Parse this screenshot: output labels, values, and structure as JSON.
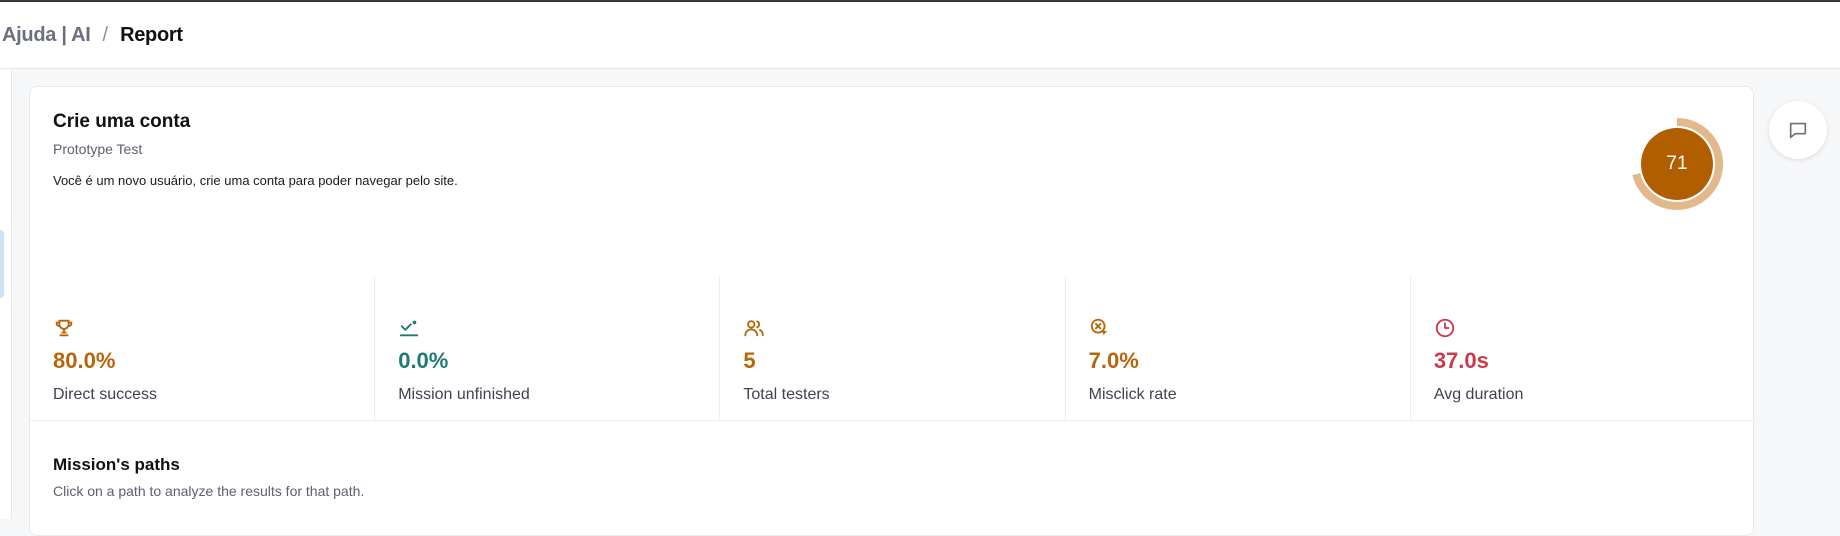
{
  "breadcrumb": {
    "root": "Ajuda | AI",
    "separator": "/",
    "current": "Report"
  },
  "mission": {
    "title": "Crie uma conta",
    "type": "Prototype Test",
    "description": "Você é um novo usuário, crie uma conta para poder navegar pelo site.",
    "score": "71",
    "score_fraction": 0.71
  },
  "stats": [
    {
      "icon": "trophy-icon",
      "value": "80.0%",
      "label": "Direct success",
      "color": "#b8650a"
    },
    {
      "icon": "path-arrow-icon",
      "value": "0.0%",
      "label": "Mission unfinished",
      "color": "#1f7a76"
    },
    {
      "icon": "users-icon",
      "value": "5",
      "label": "Total testers",
      "color": "#b8650a"
    },
    {
      "icon": "misclick-target-icon",
      "value": "7.0%",
      "label": "Misclick rate",
      "color": "#b8650a"
    },
    {
      "icon": "clock-icon",
      "value": "37.0s",
      "label": "Avg duration",
      "color": "#cc3a4a"
    }
  ],
  "paths": {
    "title": "Mission's paths",
    "subtitle": "Click on a path to analyze the results for that path."
  },
  "colors": {
    "score_fill": "#b05e00",
    "score_ring": "#e2b98b"
  }
}
